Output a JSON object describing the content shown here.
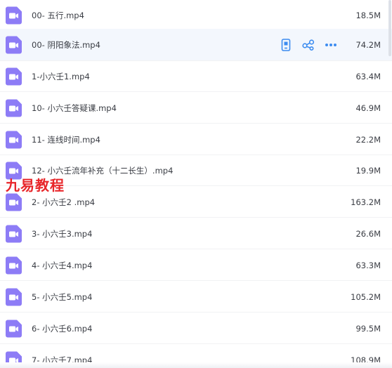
{
  "colors": {
    "video_icon_bg": "#8d7cf6",
    "action_icon": "#3c8cf0",
    "watermark": "#e8262a",
    "hover_bg": "#f3f7fd"
  },
  "files": [
    {
      "name": "00- 五行.mp4",
      "size": "18.5M",
      "icon": "video-file-icon"
    },
    {
      "name": "00- 阴阳象法.mp4",
      "size": "74.2M",
      "icon": "video-file-icon"
    },
    {
      "name": "1-小六壬1.mp4",
      "size": "63.4M",
      "icon": "video-file-icon"
    },
    {
      "name": "10- 小六壬答疑课.mp4",
      "size": "46.9M",
      "icon": "video-file-icon"
    },
    {
      "name": "11- 连线时间.mp4",
      "size": "22.2M",
      "icon": "video-file-icon"
    },
    {
      "name": "12- 小六壬流年补充（十二长生）.mp4",
      "size": "19.9M",
      "icon": "video-file-icon"
    },
    {
      "name": "2- 小六壬2 .mp4",
      "size": "163.2M",
      "icon": "video-file-icon"
    },
    {
      "name": "3- 小六壬3.mp4",
      "size": "26.6M",
      "icon": "video-file-icon"
    },
    {
      "name": "4- 小六壬4.mp4",
      "size": "63.3M",
      "icon": "video-file-icon"
    },
    {
      "name": "5- 小六壬5.mp4",
      "size": "105.2M",
      "icon": "video-file-icon"
    },
    {
      "name": "6- 小六壬6.mp4",
      "size": "99.5M",
      "icon": "video-file-icon"
    },
    {
      "name": "7- 小六壬7.mp4",
      "size": "108.9M",
      "icon": "video-file-icon"
    }
  ],
  "row_actions": {
    "icons": [
      "phone-transfer-icon",
      "share-icon",
      "more-icon"
    ]
  },
  "watermark": "九易教程"
}
